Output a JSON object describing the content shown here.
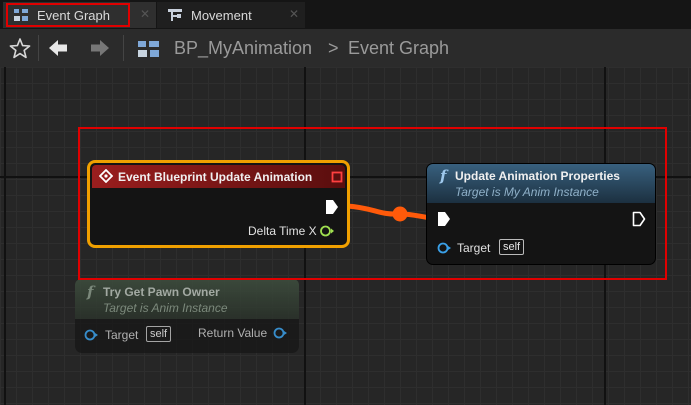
{
  "tabs": [
    {
      "label": "Event Graph",
      "icon": "event-graph-icon",
      "active": true
    },
    {
      "label": "Movement",
      "icon": "state-machine-icon",
      "active": false
    }
  ],
  "tab_close_glyph": "✕",
  "breadcrumb": {
    "blueprint": "BP_MyAnimation",
    "separator": ">",
    "graph": "Event Graph"
  },
  "nodes": {
    "event_update": {
      "title": "Event Blueprint Update Animation",
      "output_pin": "Delta Time X",
      "header_color": "#8a1a1a"
    },
    "update_props": {
      "title": "Update Animation Properties",
      "subtitle": "Target is My Anim Instance",
      "target_label": "Target",
      "target_value": "self",
      "header_color": "#2c5a7a"
    },
    "try_get_pawn": {
      "title": "Try Get Pawn Owner",
      "subtitle": "Target is Anim Instance",
      "target_label": "Target",
      "target_value": "self",
      "return_label": "Return Value",
      "header_color": "#3c4c3c"
    }
  },
  "colors": {
    "highlight": "#e00000",
    "exec_wire": "#ff5a0a",
    "selected_outline": "#f0a000",
    "object_pin": "#3aa0e8",
    "float_pin": "#a0e050"
  }
}
